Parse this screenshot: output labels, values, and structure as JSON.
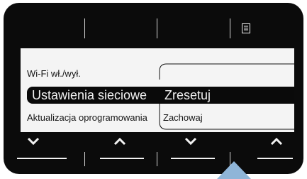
{
  "menu": {
    "items": {
      "wifi": "Wi-Fi wł./wył.",
      "network_settings": "Ustawienia sieciowe",
      "firmware_update": "Aktualizacja oprogramowania"
    },
    "submenu": {
      "reset": "Zresetuj",
      "save": "Zachowaj"
    }
  },
  "icons": {
    "top": "menu-page-icon",
    "left_down": "chevron-down-icon",
    "left_up": "chevron-up-icon",
    "right_down": "chevron-down-icon",
    "right_up": "chevron-up-icon",
    "pointer": "up-arrow-pointer-icon"
  },
  "colors": {
    "frame": "#0b0b0b",
    "screen": "#f4f4f4",
    "selection": "#0a0a0a",
    "pointer": "#8fb5d8"
  }
}
